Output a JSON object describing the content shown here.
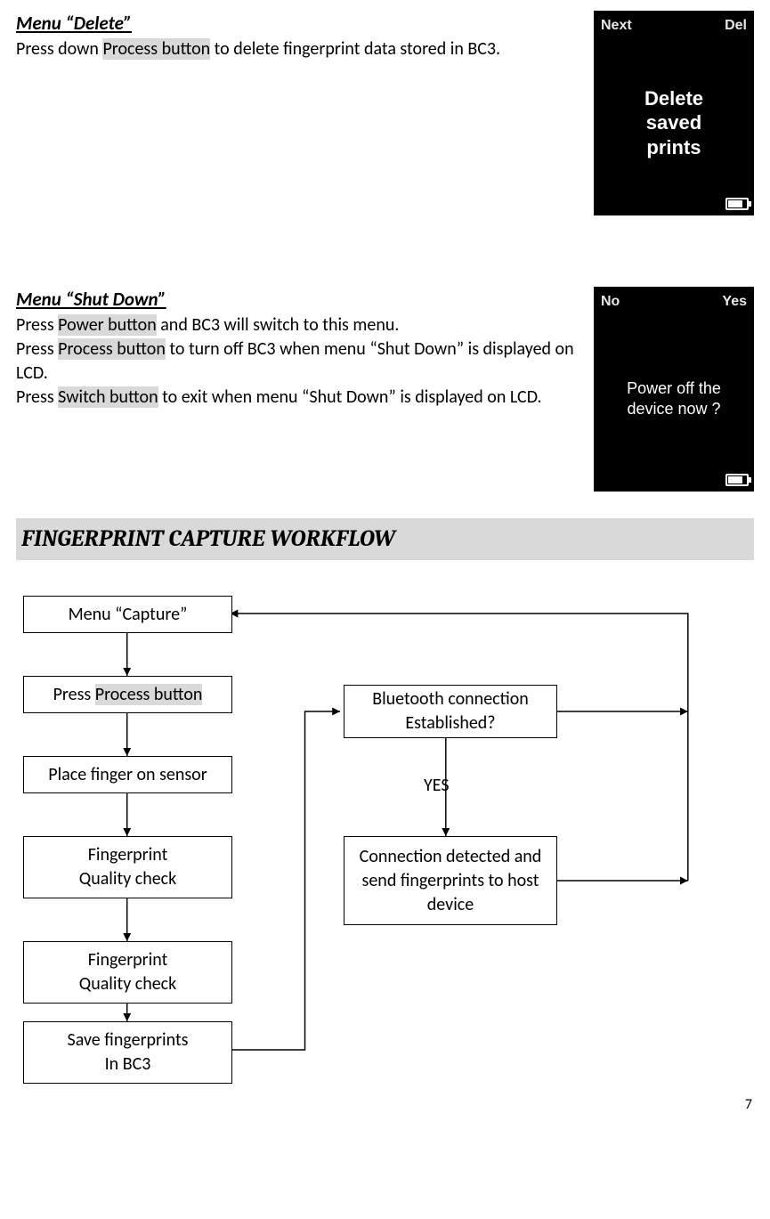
{
  "delete_section": {
    "heading": "Menu “Delete”",
    "text_pre": "Press down ",
    "btn_process": "Process button",
    "text_post": " to delete fingerprint data stored in BC3.",
    "screen_top_left": "Next",
    "screen_top_right": "Del",
    "screen_body": "Delete\nsaved\nprints"
  },
  "shutdown_section": {
    "heading": "Menu “Shut Down”",
    "l1_pre": "Press ",
    "l1_btn": "Power button",
    "l1_post": " and BC3 will switch to this menu.",
    "l2_pre": "Press ",
    "l2_btn": "Process button",
    "l2_post": " to turn off BC3 when menu “Shut Down” is displayed on LCD.",
    "l3_pre": "Press ",
    "l3_btn": "Switch button",
    "l3_post": " to exit when menu “Shut Down” is displayed on LCD.",
    "screen_top_left": "No",
    "screen_top_right": "Yes",
    "screen_body": "Power off the\ndevice now ?"
  },
  "workflow": {
    "title": "FINGERPRINT CAPTURE WORKFLOW",
    "box_menu": "Menu “Capture”",
    "box_press_pre": "Press ",
    "box_press_btn": "Process button",
    "box_place": "Place finger on sensor",
    "box_quality": "Fingerprint\nQuality check",
    "box_save": "Save fingerprints\nIn BC3",
    "box_bt": "Bluetooth connection\nEstablished?",
    "box_conn": "Connection detected and send fingerprints to host device",
    "label_yes": "YES"
  },
  "page_number": "7"
}
